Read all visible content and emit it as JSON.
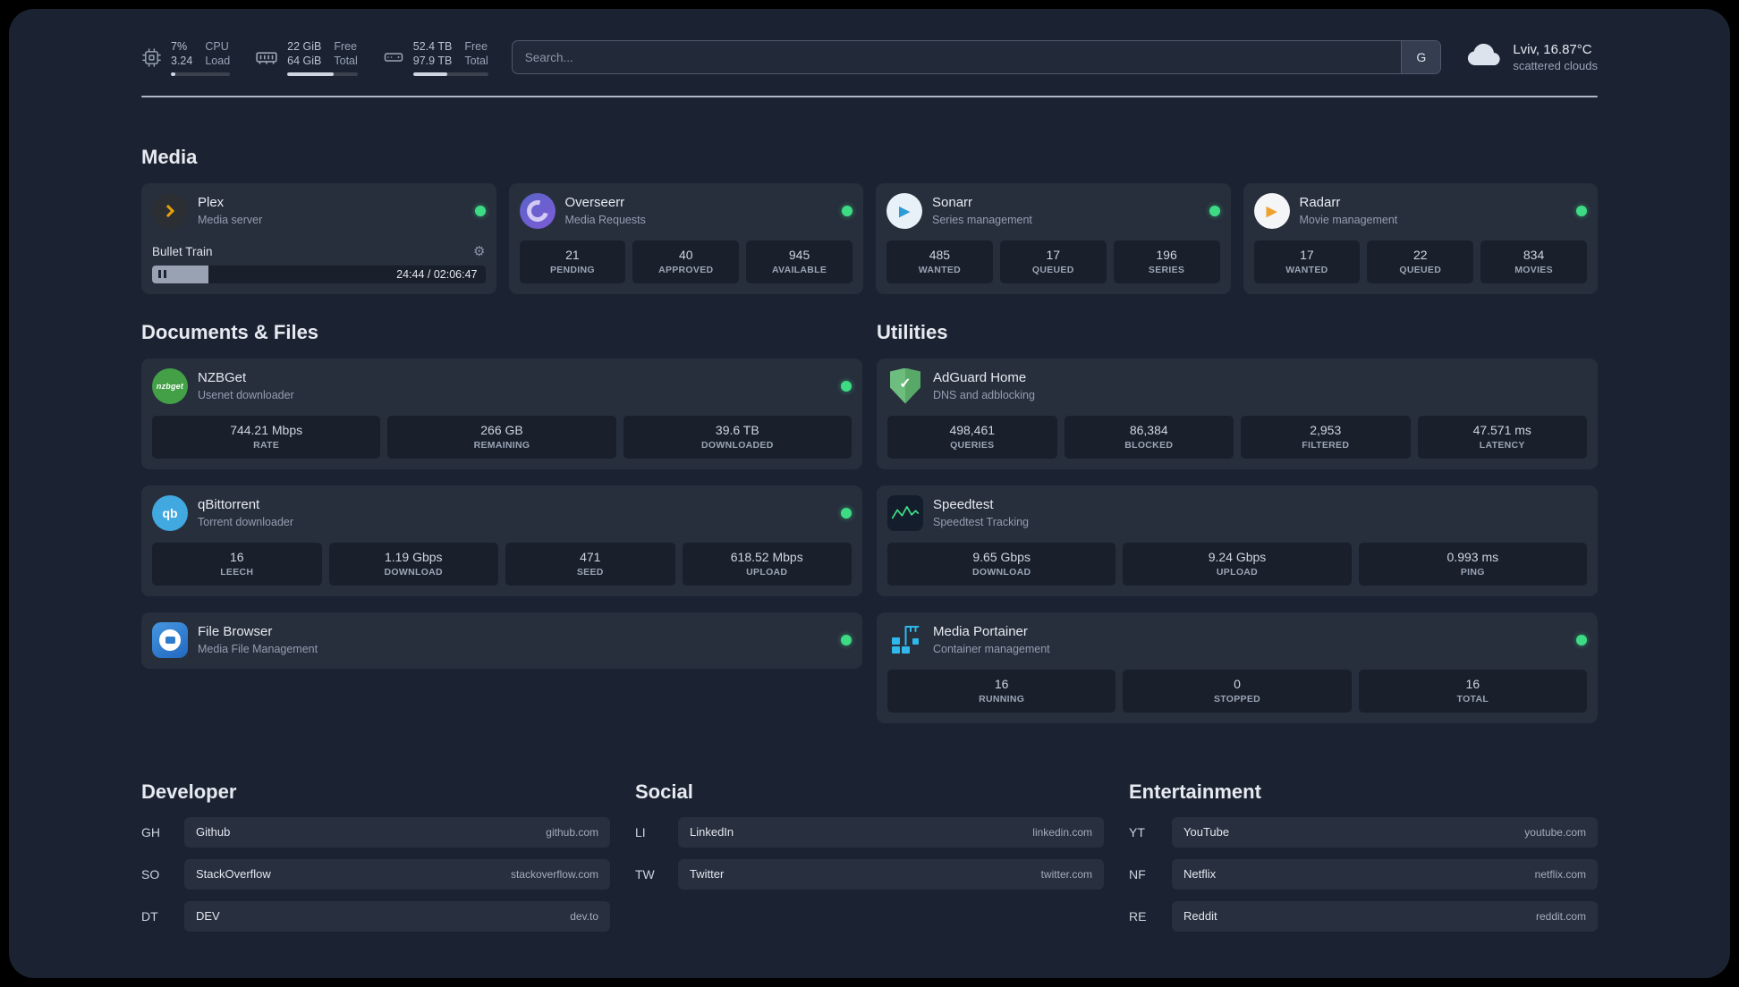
{
  "colors": {
    "status_online": "#3ddc84"
  },
  "topbar": {
    "cpu": {
      "value_top": "7%",
      "value_bottom": "3.24",
      "label_top": "CPU",
      "label_bottom": "Load",
      "bar_percent": "8%"
    },
    "memory": {
      "value_top": "22 GiB",
      "value_bottom": "64 GiB",
      "label_top": "Free",
      "label_bottom": "Total",
      "bar_percent": "66%"
    },
    "disk": {
      "value_top": "52.4 TB",
      "value_bottom": "97.9 TB",
      "label_top": "Free",
      "label_bottom": "Total",
      "bar_percent": "46%"
    },
    "search": {
      "placeholder": "Search...",
      "button_label": "G"
    },
    "weather": {
      "location": "Lviv, 16.87°C",
      "condition": "scattered clouds"
    }
  },
  "media": {
    "title": "Media",
    "plex": {
      "name": "Plex",
      "desc": "Media server",
      "now_playing": "Bullet Train",
      "time": "24:44 / 02:06:47",
      "progress_percent": "17%"
    },
    "overseerr": {
      "name": "Overseerr",
      "desc": "Media Requests",
      "stats": [
        {
          "value": "21",
          "label": "PENDING"
        },
        {
          "value": "40",
          "label": "APPROVED"
        },
        {
          "value": "945",
          "label": "AVAILABLE"
        }
      ]
    },
    "sonarr": {
      "name": "Sonarr",
      "desc": "Series management",
      "stats": [
        {
          "value": "485",
          "label": "WANTED"
        },
        {
          "value": "17",
          "label": "QUEUED"
        },
        {
          "value": "196",
          "label": "SERIES"
        }
      ]
    },
    "radarr": {
      "name": "Radarr",
      "desc": "Movie management",
      "stats": [
        {
          "value": "17",
          "label": "WANTED"
        },
        {
          "value": "22",
          "label": "QUEUED"
        },
        {
          "value": "834",
          "label": "MOVIES"
        }
      ]
    }
  },
  "documents": {
    "title": "Documents & Files",
    "nzbget": {
      "name": "NZBGet",
      "desc": "Usenet downloader",
      "icon_text": "nzbget",
      "stats": [
        {
          "value": "744.21 Mbps",
          "label": "RATE"
        },
        {
          "value": "266 GB",
          "label": "REMAINING"
        },
        {
          "value": "39.6 TB",
          "label": "DOWNLOADED"
        }
      ]
    },
    "qbittorrent": {
      "name": "qBittorrent",
      "desc": "Torrent downloader",
      "icon_text": "qb",
      "stats": [
        {
          "value": "16",
          "label": "LEECH"
        },
        {
          "value": "1.19 Gbps",
          "label": "DOWNLOAD"
        },
        {
          "value": "471",
          "label": "SEED"
        },
        {
          "value": "618.52 Mbps",
          "label": "UPLOAD"
        }
      ]
    },
    "filebrowser": {
      "name": "File Browser",
      "desc": "Media File Management"
    }
  },
  "utilities": {
    "title": "Utilities",
    "adguard": {
      "name": "AdGuard Home",
      "desc": "DNS and adblocking",
      "stats": [
        {
          "value": "498,461",
          "label": "QUERIES"
        },
        {
          "value": "86,384",
          "label": "BLOCKED"
        },
        {
          "value": "2,953",
          "label": "FILTERED"
        },
        {
          "value": "47.571 ms",
          "label": "LATENCY"
        }
      ]
    },
    "speedtest": {
      "name": "Speedtest",
      "desc": "Speedtest Tracking",
      "stats": [
        {
          "value": "9.65 Gbps",
          "label": "DOWNLOAD"
        },
        {
          "value": "9.24 Gbps",
          "label": "UPLOAD"
        },
        {
          "value": "0.993 ms",
          "label": "PING"
        }
      ]
    },
    "portainer": {
      "name": "Media Portainer",
      "desc": "Container management",
      "stats": [
        {
          "value": "16",
          "label": "RUNNING"
        },
        {
          "value": "0",
          "label": "STOPPED"
        },
        {
          "value": "16",
          "label": "TOTAL"
        }
      ]
    }
  },
  "bookmarks": {
    "developer": {
      "title": "Developer",
      "items": [
        {
          "abbr": "GH",
          "name": "Github",
          "url": "github.com"
        },
        {
          "abbr": "SO",
          "name": "StackOverflow",
          "url": "stackoverflow.com"
        },
        {
          "abbr": "DT",
          "name": "DEV",
          "url": "dev.to"
        }
      ]
    },
    "social": {
      "title": "Social",
      "items": [
        {
          "abbr": "LI",
          "name": "LinkedIn",
          "url": "linkedin.com"
        },
        {
          "abbr": "TW",
          "name": "Twitter",
          "url": "twitter.com"
        }
      ]
    },
    "entertainment": {
      "title": "Entertainment",
      "items": [
        {
          "abbr": "YT",
          "name": "YouTube",
          "url": "youtube.com"
        },
        {
          "abbr": "NF",
          "name": "Netflix",
          "url": "netflix.com"
        },
        {
          "abbr": "RE",
          "name": "Reddit",
          "url": "reddit.com"
        }
      ]
    }
  }
}
